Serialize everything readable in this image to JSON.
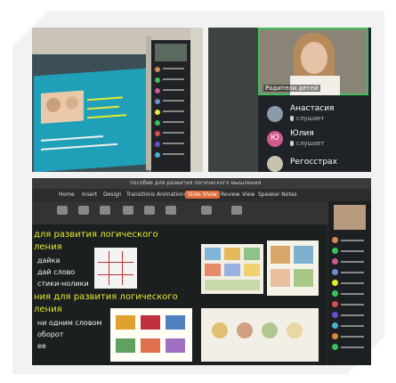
{
  "top_right": {
    "caption": "Родители детей",
    "participants": [
      {
        "name": "Анастасия",
        "status": "слушает"
      },
      {
        "name": "Юлия",
        "status": "слушает"
      },
      {
        "name": "Регосстрах",
        "status": ""
      }
    ],
    "initials": "Ю"
  },
  "bottom": {
    "window_title": "пособие для развития логического мышления",
    "ribbon_tabs": [
      "Home",
      "Insert",
      "Design",
      "Transitions",
      "Animations",
      "Slide Show",
      "Review",
      "View",
      "Speaker Notes"
    ],
    "active_tab": "Slide Show",
    "slide_lines": [
      "для развития логического",
      "ления",
      "дайка",
      "дай слово",
      "стики-нолики",
      "ния для развития логического",
      "ления",
      "ни одним словом",
      "оборот",
      "ее"
    ]
  },
  "colors": {
    "slide_text": "#e5e830",
    "slide_bg": "#1fa0b8",
    "accent_green": "#3cc05a",
    "meet_purple": "#6b4bd0"
  }
}
